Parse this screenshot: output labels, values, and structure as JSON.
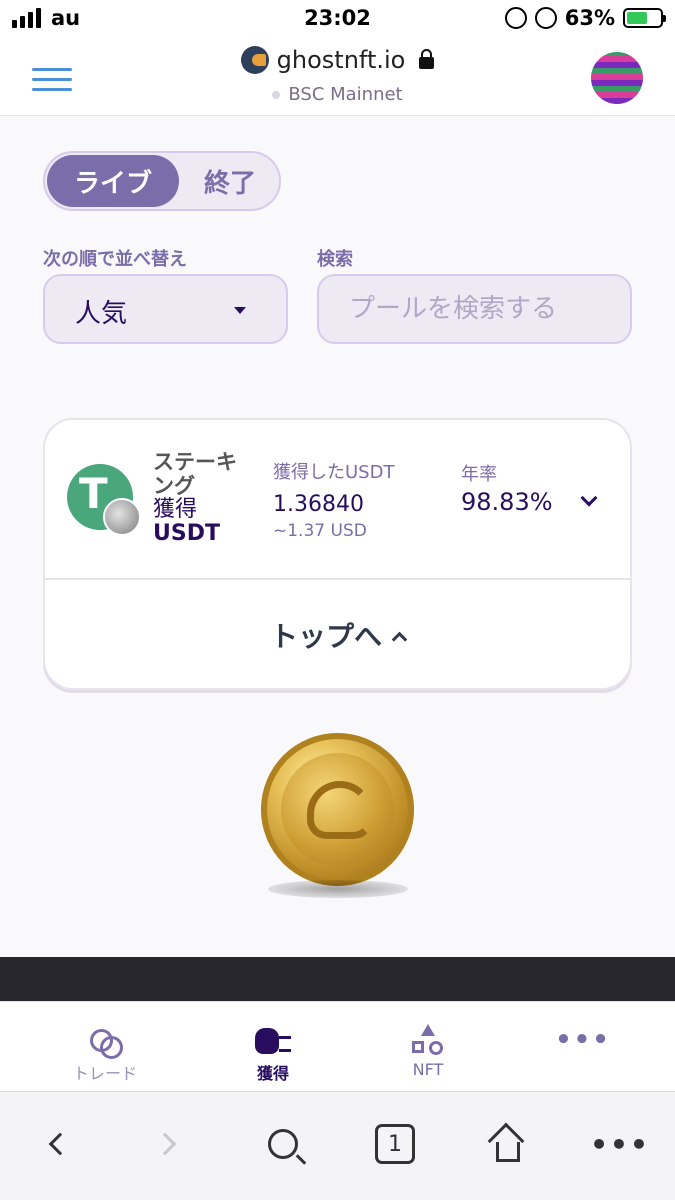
{
  "status_bar": {
    "carrier": "au",
    "time": "23:02",
    "battery": "63%"
  },
  "browser_header": {
    "site": "ghostnft.io",
    "network": "BSC Mainnet"
  },
  "toggle": {
    "live": "ライブ",
    "finished": "終了"
  },
  "sort": {
    "label": "次の順で並べ替え",
    "value": "人気"
  },
  "search": {
    "label": "検索",
    "placeholder": "プールを検索する"
  },
  "pool": {
    "name_line1": "ステーキ",
    "name_line2": "ング",
    "name_line3": "獲得",
    "name_line4": "USDT",
    "earned_label": "獲得したUSDT",
    "earned_amount": "1.36840",
    "earned_usd": "~1.37 USD",
    "apr_label": "年率",
    "apr_value": "98.83%",
    "to_top": "トップへ"
  },
  "bottom_nav": [
    {
      "label": "トレード",
      "icon": "trade-icon"
    },
    {
      "label": "獲得",
      "icon": "earn-icon"
    },
    {
      "label": "NFT",
      "icon": "nft-icon"
    },
    {
      "label": "",
      "icon": "more-icon"
    }
  ],
  "browser_toolbar": {
    "tab_count": "1"
  },
  "colors": {
    "primary": "#7a6eaa",
    "text": "#280d5f",
    "accent_green": "#4aa67b"
  }
}
